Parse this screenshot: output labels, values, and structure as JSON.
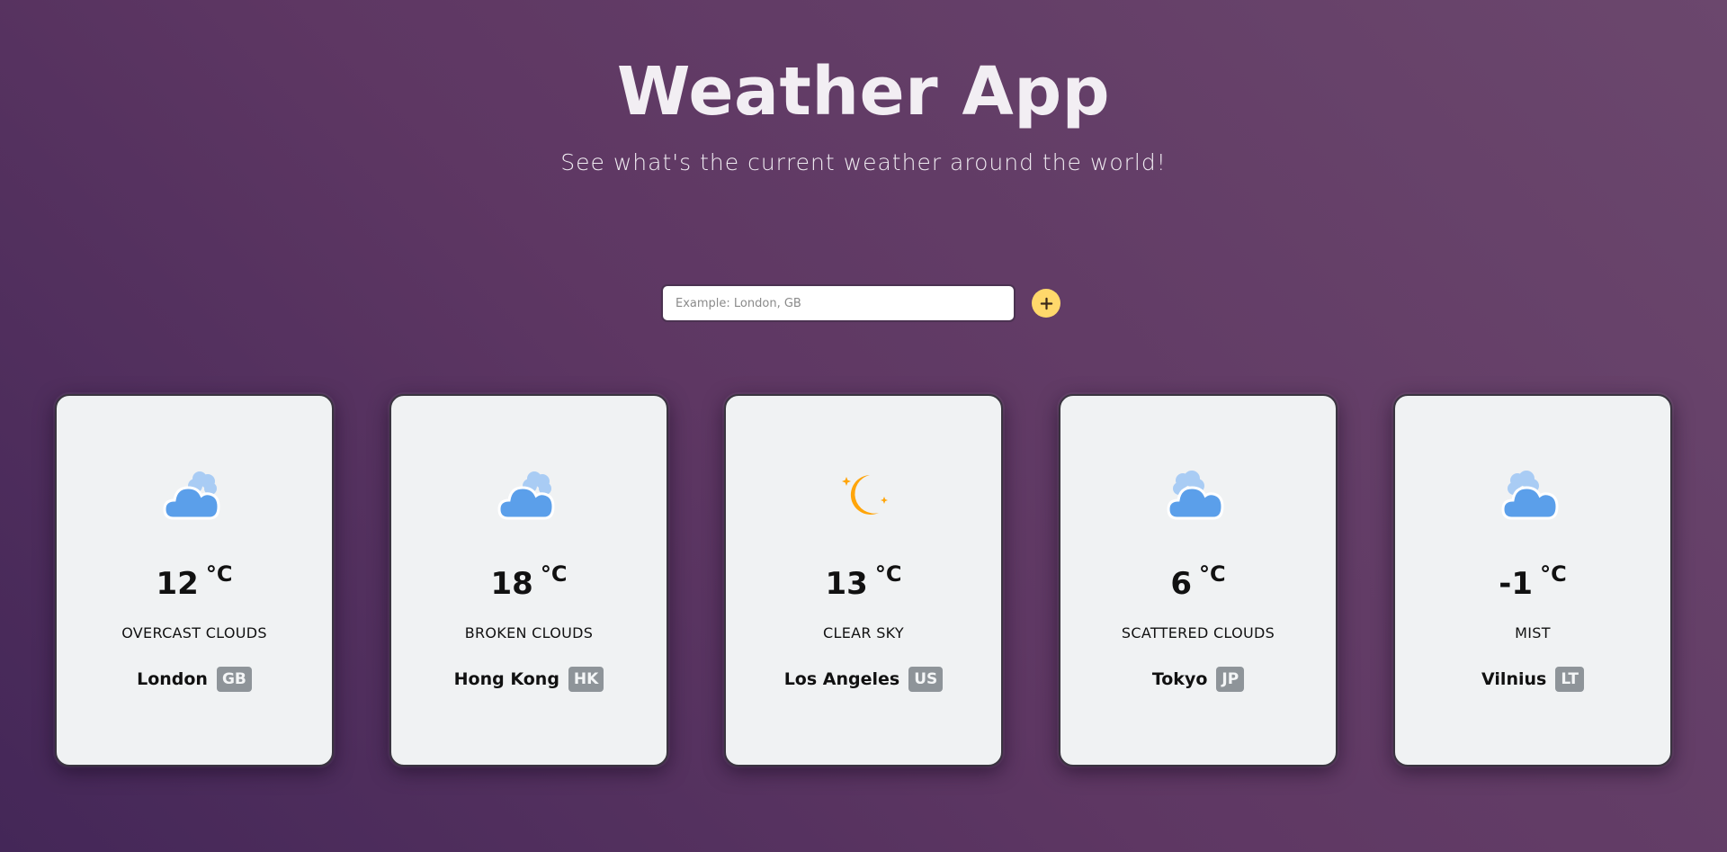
{
  "header": {
    "title": "Weather App",
    "subtitle": "See what's the current weather around the world!"
  },
  "search": {
    "placeholder": "Example: London, GB",
    "value": "",
    "add_button_icon": "plus-icon",
    "add_button_color": "#ffd86b"
  },
  "cards": [
    {
      "icon": "clouds-icon",
      "temperature": "12",
      "unit": "°C",
      "description": "OVERCAST CLOUDS",
      "city": "London",
      "country": "GB"
    },
    {
      "icon": "clouds-icon",
      "temperature": "18",
      "unit": "°C",
      "description": "BROKEN CLOUDS",
      "city": "Hong Kong",
      "country": "HK"
    },
    {
      "icon": "clear-night-moon-icon",
      "temperature": "13",
      "unit": "°C",
      "description": "CLEAR SKY",
      "city": "Los Angeles",
      "country": "US"
    },
    {
      "icon": "clouds-icon",
      "temperature": "6",
      "unit": "°C",
      "description": "SCATTERED CLOUDS",
      "city": "Tokyo",
      "country": "JP"
    },
    {
      "icon": "clouds-icon",
      "temperature": "-1",
      "unit": "°C",
      "description": "MIST",
      "city": "Vilnius",
      "country": "LT"
    }
  ],
  "colors": {
    "background_start": "#442758",
    "background_end": "#6b476d",
    "card_background": "#f0f2f3",
    "cloud_blue": "#5b9fea",
    "moon_orange": "#ffa50a",
    "badge_gray": "#8e9499"
  }
}
